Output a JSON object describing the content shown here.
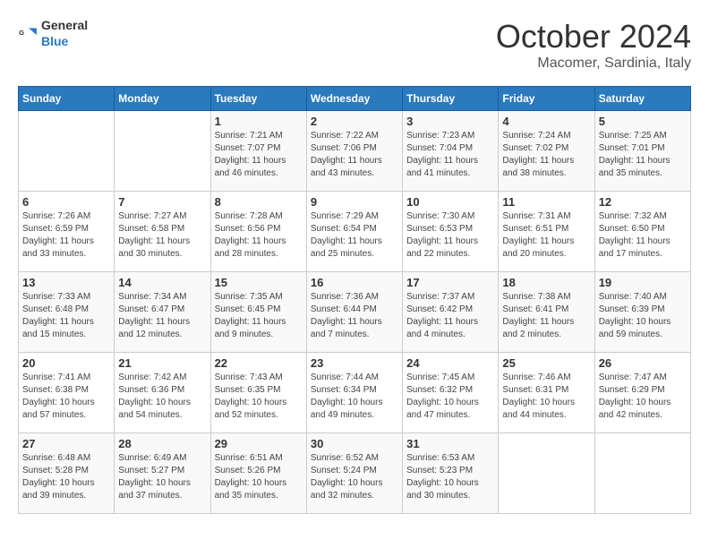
{
  "header": {
    "logo_general": "General",
    "logo_blue": "Blue",
    "month": "October 2024",
    "location": "Macomer, Sardinia, Italy"
  },
  "weekdays": [
    "Sunday",
    "Monday",
    "Tuesday",
    "Wednesday",
    "Thursday",
    "Friday",
    "Saturday"
  ],
  "weeks": [
    [
      {
        "day": "",
        "content": ""
      },
      {
        "day": "",
        "content": ""
      },
      {
        "day": "1",
        "content": "Sunrise: 7:21 AM\nSunset: 7:07 PM\nDaylight: 11 hours and 46 minutes."
      },
      {
        "day": "2",
        "content": "Sunrise: 7:22 AM\nSunset: 7:06 PM\nDaylight: 11 hours and 43 minutes."
      },
      {
        "day": "3",
        "content": "Sunrise: 7:23 AM\nSunset: 7:04 PM\nDaylight: 11 hours and 41 minutes."
      },
      {
        "day": "4",
        "content": "Sunrise: 7:24 AM\nSunset: 7:02 PM\nDaylight: 11 hours and 38 minutes."
      },
      {
        "day": "5",
        "content": "Sunrise: 7:25 AM\nSunset: 7:01 PM\nDaylight: 11 hours and 35 minutes."
      }
    ],
    [
      {
        "day": "6",
        "content": "Sunrise: 7:26 AM\nSunset: 6:59 PM\nDaylight: 11 hours and 33 minutes."
      },
      {
        "day": "7",
        "content": "Sunrise: 7:27 AM\nSunset: 6:58 PM\nDaylight: 11 hours and 30 minutes."
      },
      {
        "day": "8",
        "content": "Sunrise: 7:28 AM\nSunset: 6:56 PM\nDaylight: 11 hours and 28 minutes."
      },
      {
        "day": "9",
        "content": "Sunrise: 7:29 AM\nSunset: 6:54 PM\nDaylight: 11 hours and 25 minutes."
      },
      {
        "day": "10",
        "content": "Sunrise: 7:30 AM\nSunset: 6:53 PM\nDaylight: 11 hours and 22 minutes."
      },
      {
        "day": "11",
        "content": "Sunrise: 7:31 AM\nSunset: 6:51 PM\nDaylight: 11 hours and 20 minutes."
      },
      {
        "day": "12",
        "content": "Sunrise: 7:32 AM\nSunset: 6:50 PM\nDaylight: 11 hours and 17 minutes."
      }
    ],
    [
      {
        "day": "13",
        "content": "Sunrise: 7:33 AM\nSunset: 6:48 PM\nDaylight: 11 hours and 15 minutes."
      },
      {
        "day": "14",
        "content": "Sunrise: 7:34 AM\nSunset: 6:47 PM\nDaylight: 11 hours and 12 minutes."
      },
      {
        "day": "15",
        "content": "Sunrise: 7:35 AM\nSunset: 6:45 PM\nDaylight: 11 hours and 9 minutes."
      },
      {
        "day": "16",
        "content": "Sunrise: 7:36 AM\nSunset: 6:44 PM\nDaylight: 11 hours and 7 minutes."
      },
      {
        "day": "17",
        "content": "Sunrise: 7:37 AM\nSunset: 6:42 PM\nDaylight: 11 hours and 4 minutes."
      },
      {
        "day": "18",
        "content": "Sunrise: 7:38 AM\nSunset: 6:41 PM\nDaylight: 11 hours and 2 minutes."
      },
      {
        "day": "19",
        "content": "Sunrise: 7:40 AM\nSunset: 6:39 PM\nDaylight: 10 hours and 59 minutes."
      }
    ],
    [
      {
        "day": "20",
        "content": "Sunrise: 7:41 AM\nSunset: 6:38 PM\nDaylight: 10 hours and 57 minutes."
      },
      {
        "day": "21",
        "content": "Sunrise: 7:42 AM\nSunset: 6:36 PM\nDaylight: 10 hours and 54 minutes."
      },
      {
        "day": "22",
        "content": "Sunrise: 7:43 AM\nSunset: 6:35 PM\nDaylight: 10 hours and 52 minutes."
      },
      {
        "day": "23",
        "content": "Sunrise: 7:44 AM\nSunset: 6:34 PM\nDaylight: 10 hours and 49 minutes."
      },
      {
        "day": "24",
        "content": "Sunrise: 7:45 AM\nSunset: 6:32 PM\nDaylight: 10 hours and 47 minutes."
      },
      {
        "day": "25",
        "content": "Sunrise: 7:46 AM\nSunset: 6:31 PM\nDaylight: 10 hours and 44 minutes."
      },
      {
        "day": "26",
        "content": "Sunrise: 7:47 AM\nSunset: 6:29 PM\nDaylight: 10 hours and 42 minutes."
      }
    ],
    [
      {
        "day": "27",
        "content": "Sunrise: 6:48 AM\nSunset: 5:28 PM\nDaylight: 10 hours and 39 minutes."
      },
      {
        "day": "28",
        "content": "Sunrise: 6:49 AM\nSunset: 5:27 PM\nDaylight: 10 hours and 37 minutes."
      },
      {
        "day": "29",
        "content": "Sunrise: 6:51 AM\nSunset: 5:26 PM\nDaylight: 10 hours and 35 minutes."
      },
      {
        "day": "30",
        "content": "Sunrise: 6:52 AM\nSunset: 5:24 PM\nDaylight: 10 hours and 32 minutes."
      },
      {
        "day": "31",
        "content": "Sunrise: 6:53 AM\nSunset: 5:23 PM\nDaylight: 10 hours and 30 minutes."
      },
      {
        "day": "",
        "content": ""
      },
      {
        "day": "",
        "content": ""
      }
    ]
  ]
}
